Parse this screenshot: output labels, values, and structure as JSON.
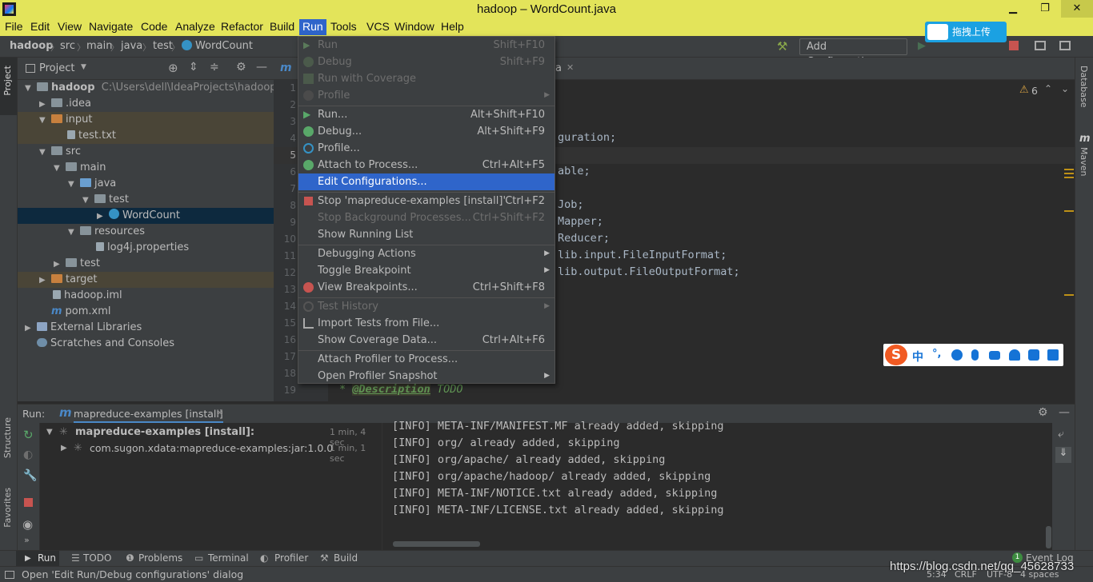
{
  "window": {
    "title": "hadoop – WordCount.java",
    "minimize": "▁",
    "maximize": "❐",
    "close": "✕"
  },
  "menubar": {
    "items": [
      "File",
      "Edit",
      "View",
      "Navigate",
      "Code",
      "Analyze",
      "Refactor",
      "Build",
      "Run",
      "Tools",
      "VCS",
      "Window",
      "Help"
    ],
    "active": "Run"
  },
  "breadcrumb": [
    "hadoop",
    "src",
    "main",
    "java",
    "test",
    "WordCount"
  ],
  "toolbar": {
    "add_configuration": "Add Configuration...",
    "upload_label": "拖拽上传"
  },
  "left_strip": {
    "project": "Project",
    "structure": "Structure",
    "favorites": "Favorites"
  },
  "right_strip": {
    "database": "Database",
    "maven": "Maven"
  },
  "project_panel": {
    "title": "Project",
    "tree": [
      {
        "label": "hadoop",
        "extra": "C:\\Users\\dell\\IdeaProjects\\hadoop"
      },
      {
        "label": ".idea"
      },
      {
        "label": "input"
      },
      {
        "label": "test.txt"
      },
      {
        "label": "src"
      },
      {
        "label": "main"
      },
      {
        "label": "java"
      },
      {
        "label": "test"
      },
      {
        "label": "WordCount"
      },
      {
        "label": "resources"
      },
      {
        "label": "log4j.properties"
      },
      {
        "label": "test"
      },
      {
        "label": "target"
      },
      {
        "label": "hadoop.iml"
      },
      {
        "label": "pom.xml"
      },
      {
        "label": "External Libraries"
      },
      {
        "label": "Scratches and Consoles"
      }
    ]
  },
  "editor": {
    "tab_fragment": "a",
    "warnings": "6",
    "line_numbers": [
      "1",
      "2",
      "3",
      "4",
      "5",
      "6",
      "7",
      "8",
      "9",
      "10",
      "11",
      "12",
      "13",
      "14",
      "15",
      "16",
      "17",
      "18",
      "19"
    ],
    "code_fragments": [
      "guration;",
      "able;",
      "Job;",
      "Mapper;",
      "Reducer;",
      "lib.input.FileInputFormat;",
      "lib.output.FileOutputFormat;"
    ],
    "doc_line": {
      "star": "*",
      "tag": "@Description",
      "text": "TODO"
    }
  },
  "run_menu": {
    "items": [
      {
        "label": "Run",
        "shortcut": "Shift+F10",
        "disabled": true
      },
      {
        "label": "Debug",
        "shortcut": "Shift+F9",
        "disabled": true
      },
      {
        "label": "Run with Coverage",
        "shortcut": "",
        "disabled": true
      },
      {
        "label": "Profile",
        "shortcut": "",
        "disabled": true,
        "submenu": true
      },
      {
        "label": "Run...",
        "shortcut": "Alt+Shift+F10"
      },
      {
        "label": "Debug...",
        "shortcut": "Alt+Shift+F9"
      },
      {
        "label": "Profile...",
        "shortcut": ""
      },
      {
        "label": "Attach to Process...",
        "shortcut": "Ctrl+Alt+F5"
      },
      {
        "label": "Edit Configurations...",
        "shortcut": "",
        "selected": true
      },
      {
        "label": "Stop 'mapreduce-examples [install]'",
        "shortcut": "Ctrl+F2"
      },
      {
        "label": "Stop Background Processes...",
        "shortcut": "Ctrl+Shift+F2",
        "disabled": true
      },
      {
        "label": "Show Running List",
        "shortcut": ""
      },
      {
        "label": "Debugging Actions",
        "shortcut": "",
        "submenu": true
      },
      {
        "label": "Toggle Breakpoint",
        "shortcut": "",
        "submenu": true
      },
      {
        "label": "View Breakpoints...",
        "shortcut": "Ctrl+Shift+F8"
      },
      {
        "label": "Test History",
        "shortcut": "",
        "disabled": true,
        "submenu": true
      },
      {
        "label": "Import Tests from File...",
        "shortcut": ""
      },
      {
        "label": "Show Coverage Data...",
        "shortcut": "Ctrl+Alt+F6"
      },
      {
        "label": "Attach Profiler to Process...",
        "shortcut": ""
      },
      {
        "label": "Open Profiler Snapshot",
        "shortcut": "",
        "submenu": true
      }
    ]
  },
  "run_panel": {
    "label": "Run:",
    "tab": "mapreduce-examples [install]",
    "tree": [
      {
        "label": "mapreduce-examples [install]:",
        "time": "1 min, 4 sec"
      },
      {
        "label": "com.sugon.xdata:mapreduce-examples:jar:1.0.0",
        "time": "1 min, 1 sec"
      }
    ],
    "console": [
      "[INFO] META-INF/MANIFEST.MF already added, skipping",
      "[INFO] org/ already added, skipping",
      "[INFO] org/apache/ already added, skipping",
      "[INFO] org/apache/hadoop/ already added, skipping",
      "[INFO] META-INF/NOTICE.txt already added, skipping",
      "[INFO] META-INF/LICENSE.txt already added, skipping"
    ]
  },
  "bottom_tabs": [
    "Run",
    "TODO",
    "Problems",
    "Terminal",
    "Profiler",
    "Build"
  ],
  "event_log": {
    "count": "1",
    "label": "Event Log"
  },
  "status": {
    "message": "Open 'Edit Run/Debug configurations' dialog",
    "position": "5:34",
    "line_sep": "CRLF",
    "encoding": "UTF-8",
    "indent": "4 spaces",
    "watermark": "https://blog.csdn.net/qq_45628733"
  },
  "ime": {
    "logo": "S",
    "mode": "中",
    "punct": "°,"
  },
  "colors": {
    "title_bg": "#e3e45a",
    "menu_select": "#2f65ca",
    "panel": "#3c3f41",
    "editor": "#2b2b2b",
    "highlight_row": "#4a4537",
    "selected_row": "#0d293e"
  }
}
